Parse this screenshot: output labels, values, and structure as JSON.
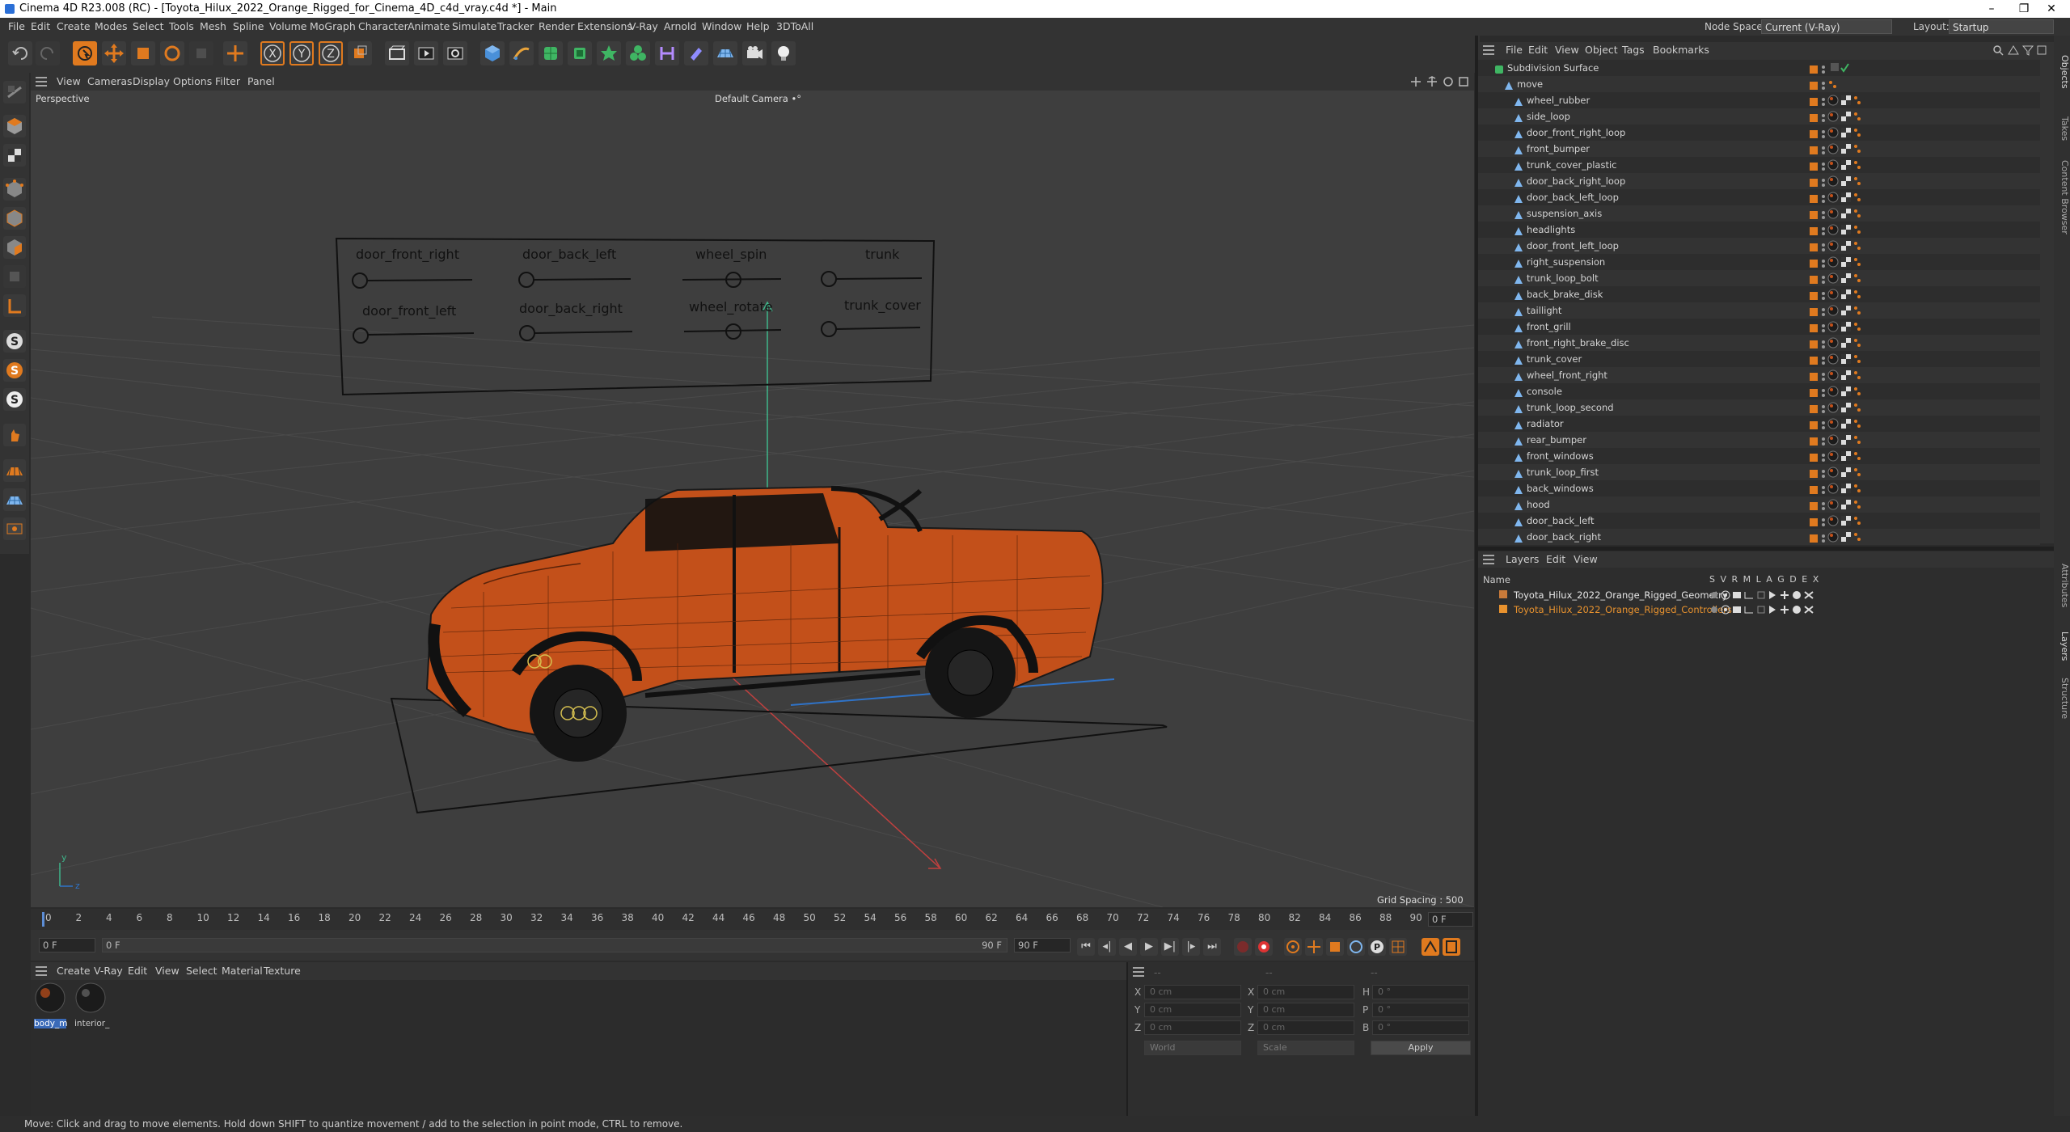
{
  "window": {
    "title": "Cinema 4D R23.008 (RC) - [Toyota_Hilux_2022_Orange_Rigged_for_Cinema_4D_c4d_vray.c4d *] - Main",
    "minimize": "–",
    "maximize": "❐",
    "close": "✕"
  },
  "menubar": {
    "items": [
      "File",
      "Edit",
      "Create",
      "Modes",
      "Select",
      "Tools",
      "Mesh",
      "Spline",
      "Volume",
      "MoGraph",
      "Character",
      "Animate",
      "Simulate",
      "Tracker",
      "Render",
      "Extensions",
      "V-Ray",
      "Arnold",
      "Window",
      "Help",
      "3DToAll"
    ],
    "node_space_label": "Node Space:",
    "node_space_value": "Current (V-Ray)",
    "layout_label": "Layout:",
    "layout_value": "Startup"
  },
  "toolbar": {
    "axis_x": "X",
    "axis_y": "Y",
    "axis_z": "Z"
  },
  "viewport": {
    "menu": [
      "View",
      "Cameras",
      "Display",
      "Options",
      "Filter",
      "Panel"
    ],
    "projection": "Perspective",
    "camera": "Default Camera",
    "camera_mark": "•°",
    "grid_spacing": "Grid Spacing : 500 cm",
    "axis_y": "y",
    "axis_z": "z",
    "controller_board": {
      "row1": [
        "door_front_right",
        "door_back_left",
        "wheel_spin",
        "trunk"
      ],
      "row2": [
        "door_front_left",
        "door_back_right",
        "wheel_rotate",
        "trunk_cover"
      ]
    }
  },
  "timeline": {
    "ticks": [
      "0",
      "2",
      "4",
      "6",
      "8",
      "10",
      "12",
      "14",
      "16",
      "18",
      "20",
      "22",
      "24",
      "26",
      "28",
      "30",
      "32",
      "34",
      "36",
      "38",
      "40",
      "42",
      "44",
      "46",
      "48",
      "50",
      "52",
      "54",
      "56",
      "58",
      "60",
      "62",
      "64",
      "66",
      "68",
      "70",
      "72",
      "74",
      "76",
      "78",
      "80",
      "82",
      "84",
      "86",
      "88",
      "90"
    ],
    "end_field": "0 F"
  },
  "transport": {
    "current_frame": "0 F",
    "start_frame": "0 F",
    "end_frame": "90 F",
    "max_frame": "90 F",
    "goto_start": "⏮",
    "prev_key": "◂|",
    "prev_frame": "◀",
    "play": "▶",
    "next_frame": "▶|",
    "next_key": "|▸",
    "goto_end": "⏭"
  },
  "materials": {
    "menu": [
      "Create",
      "V-Ray",
      "Edit",
      "View",
      "Select",
      "Material",
      "Texture"
    ],
    "items": [
      "body_m",
      "interior_"
    ]
  },
  "coordinates": {
    "rows": [
      {
        "a": "X",
        "av": "0 cm",
        "b": "X",
        "bv": "0 cm",
        "c": "H",
        "cv": "0 °"
      },
      {
        "a": "Y",
        "av": "0 cm",
        "b": "Y",
        "bv": "0 cm",
        "c": "P",
        "cv": "0 °"
      },
      {
        "a": "Z",
        "av": "0 cm",
        "b": "Z",
        "bv": "0 cm",
        "c": "B",
        "cv": "0 °"
      }
    ],
    "col1_header": "--",
    "col2_header": "--",
    "col3_header": "--",
    "mode": "World",
    "scale": "Scale",
    "apply": "Apply"
  },
  "status": "Move: Click and drag to move elements. Hold down SHIFT to quantize movement / add to the selection in point mode, CTRL to remove.",
  "object_manager": {
    "menu": [
      "File",
      "Edit",
      "View",
      "Object",
      "Tags",
      "Bookmarks"
    ],
    "root": "Subdivision Surface",
    "group": "move",
    "children": [
      "wheel_rubber",
      "side_loop",
      "door_front_right_loop",
      "front_bumper",
      "trunk_cover_plastic",
      "door_back_right_loop",
      "door_back_left_loop",
      "suspension_axis",
      "headlights",
      "door_front_left_loop",
      "right_suspension",
      "trunk_loop_bolt",
      "back_brake_disk",
      "taillight",
      "front_grill",
      "front_right_brake_disc",
      "trunk_cover",
      "wheel_front_right",
      "console",
      "trunk_loop_second",
      "radiator",
      "rear_bumper",
      "front_windows",
      "trunk_loop_first",
      "back_windows",
      "hood",
      "door_back_left",
      "door_back_right"
    ]
  },
  "layers": {
    "menu": [
      "Layers",
      "Edit",
      "View"
    ],
    "header_name": "Name",
    "header_cols": "S V R M L A G D E X",
    "items": [
      {
        "name": "Toyota_Hilux_2022_Orange_Rigged_Geometry",
        "color": "#c87a3a"
      },
      {
        "name": "Toyota_Hilux_2022_Orange_Rigged_Controllers",
        "color": "#e8922e"
      }
    ]
  },
  "side_tabs": [
    "Objects",
    "Takes",
    "Content Browser",
    "Attributes",
    "Layers",
    "Structure"
  ],
  "colors": {
    "accent_orange": "#e07a1f",
    "car_orange": "#c3501a",
    "viewport_bg": "#3e3e3e"
  }
}
